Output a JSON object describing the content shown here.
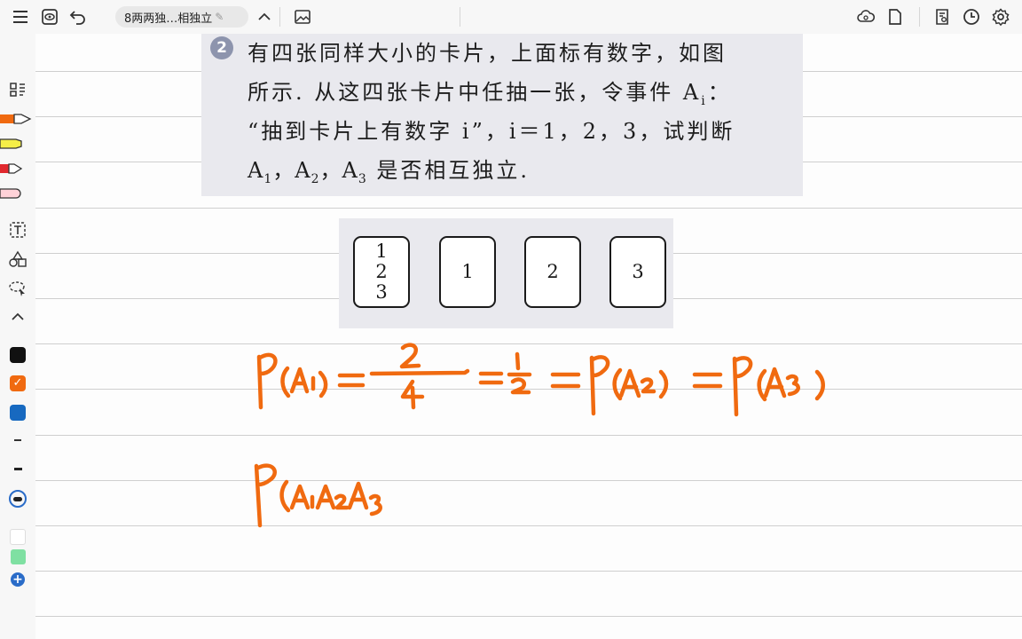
{
  "toolbar": {
    "document_title": "8两两独…相独立",
    "icons": [
      "menu-icon",
      "view-icon",
      "undo-icon",
      "chevron-up-icon",
      "image-icon",
      "cloud-icon",
      "page-icon",
      "search-doc-icon",
      "clock-icon",
      "settings-icon"
    ]
  },
  "textbook": {
    "question_number": "2",
    "lines": [
      "有四张同样大小的卡片，上面标有数字，如图",
      "所示. 从这四张卡片中任抽一张，令事件 A",
      "“抽到卡片上有数字 i”，i＝1，2，3，试判断",
      "A",
      "是否相互独立."
    ],
    "line2_sub": "i",
    "line2_end": "：",
    "line4_parts": [
      "A",
      "1",
      "，A",
      "2",
      "，A",
      "3",
      " 是否相互独立."
    ]
  },
  "cards": [
    {
      "numbers": [
        "1",
        "2",
        "3"
      ]
    },
    {
      "numbers": [
        "1"
      ]
    },
    {
      "numbers": [
        "2"
      ]
    },
    {
      "numbers": [
        "3"
      ]
    }
  ],
  "handwriting": {
    "line1": "P(A1) = 2/4 = 1/2 = P(A2) = P(A3)",
    "line2": "P(A1A2A3"
  },
  "sidebar": {
    "tools": [
      "layout-icon",
      "pen-orange",
      "highlighter-yellow",
      "pen-red",
      "eraser",
      "text-tool-icon",
      "shapes-icon",
      "lasso-icon",
      "collapse-icon"
    ],
    "colors": [
      "#111111",
      "#f06a10",
      "#1769c0"
    ],
    "selected_color": "#f06a10",
    "extra_colors": [
      "#ffffff",
      "#7fe0a2"
    ]
  }
}
